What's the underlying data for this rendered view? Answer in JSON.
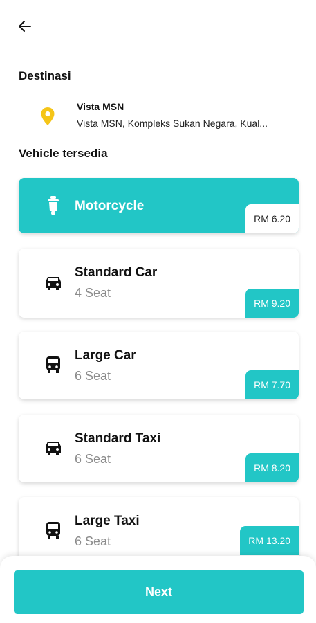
{
  "header": {
    "back_icon": "arrow-left-icon"
  },
  "destination": {
    "title": "Destinasi",
    "name": "Vista MSN",
    "address": "Vista MSN, Kompleks Sukan Negara, Kual...",
    "pin_icon": "location-pin-icon",
    "pin_color": "#f5c518"
  },
  "vehicles": {
    "title": "Vehicle tersedia",
    "items": [
      {
        "name": "Motorcycle",
        "seat": "",
        "price": "RM 6.20",
        "icon": "scooter-icon",
        "selected": true
      },
      {
        "name": "Standard Car",
        "seat": "4 Seat",
        "price": "RM 9.20",
        "icon": "car-icon",
        "selected": false
      },
      {
        "name": "Large Car",
        "seat": "6 Seat",
        "price": "RM 7.70",
        "icon": "bus-icon",
        "selected": false
      },
      {
        "name": "Standard Taxi",
        "seat": "6 Seat",
        "price": "RM 8.20",
        "icon": "car-icon",
        "selected": false
      },
      {
        "name": "Large Taxi",
        "seat": "6 Seat",
        "price": "RM 13.20",
        "icon": "bus-icon",
        "selected": false
      }
    ]
  },
  "footer": {
    "next_label": "Next"
  },
  "colors": {
    "accent": "#22c6c6",
    "text": "#111111",
    "muted": "#8c8c8c"
  }
}
